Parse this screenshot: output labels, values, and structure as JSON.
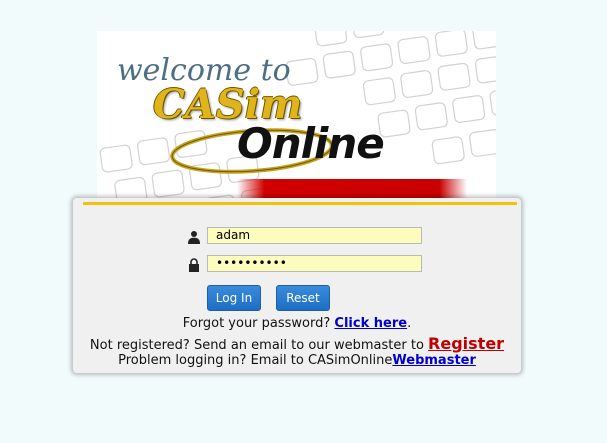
{
  "banner": {
    "welcome": "welcome to",
    "casim": "CASim",
    "online": "Online"
  },
  "login": {
    "username_value": "adam",
    "password_value": "••••••••••",
    "login_button": "Log In",
    "reset_button": "Reset"
  },
  "help": {
    "forgot_prefix": "Forgot your password? ",
    "forgot_link": "Click here",
    "forgot_suffix": ".",
    "register_prefix": "Not registered? Send an email to our webmaster to ",
    "register_link": "Register",
    "problem_prefix": "Problem logging in? Email to CASimOnline",
    "problem_link": "Webmaster"
  },
  "colors": {
    "accent_line": "#f3c20b",
    "button": "#2a7cd2",
    "field_bg": "#fcfcbd",
    "register_link": "#c00000",
    "link": "#0000cc"
  },
  "icons": {
    "user": "user-icon",
    "password": "lock-icon"
  }
}
